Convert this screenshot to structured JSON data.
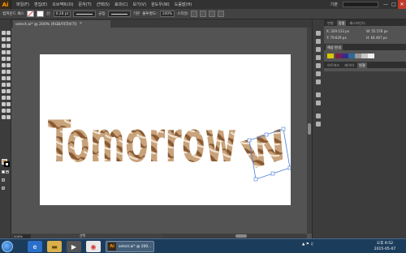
{
  "app": {
    "logo": "Ai",
    "menu": [
      "파일(F)",
      "편집(E)",
      "오브젝트(O)",
      "문자(T)",
      "선택(S)",
      "효과(C)",
      "보기(V)",
      "윈도우(W)",
      "도움말(H)"
    ],
    "workspace": "기본",
    "window_controls": [
      "—",
      "□",
      "✕"
    ]
  },
  "controlbar": {
    "selection_label": "컴파운드 패스",
    "stroke_label": "선:",
    "stroke_weight": "0.28 pt",
    "uniform_label": "균등",
    "basic_label": "기본",
    "opacity_label": "불투명도:",
    "opacity_value": "100%",
    "style_label": "스타일:"
  },
  "document": {
    "tab_title": "select.ai* @ 200% (RGB/미리보기)",
    "tab_close": "✕"
  },
  "artwork": {
    "text": "Tomorrow"
  },
  "status": {
    "zoom": "200%",
    "tool": "선택"
  },
  "panels": {
    "top_tabs": [
      "변형",
      "정렬",
      "패스파인더"
    ],
    "transform": {
      "x": "X: 329.133 px",
      "y": "Y: 79.629 px",
      "w": "W: 55.578 px",
      "h": "H: 64.467 px"
    },
    "color_tabs": [
      "색상 안내"
    ],
    "swatch_colors": [
      "#d8c800",
      "#7a1f4a",
      "#3b2a8c",
      "#2a6b9c",
      "#9a9a9a",
      "#c8c8c8",
      "#f0f0f0"
    ],
    "layer_tabs": [
      "아트보드",
      "레이어",
      "연결"
    ]
  },
  "taskbar": {
    "ai_label": "select.ai* @ 200...",
    "tray": "▲  ⚑  ♫",
    "time": "오후 9:52",
    "date": "2015-05-07"
  }
}
